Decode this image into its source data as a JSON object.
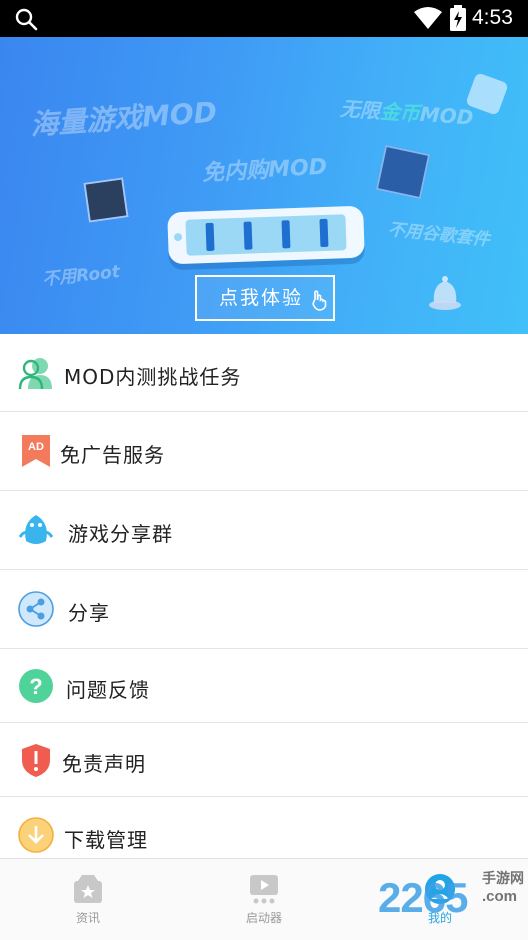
{
  "status_bar": {
    "time": "4:53"
  },
  "banner": {
    "text_1": "海量游戏MOD",
    "text_2_prefix": "无限",
    "text_2_highlight": "金币",
    "text_2_suffix": "MOD",
    "text_3": "免内购MOD",
    "text_4": "不用谷歌套件",
    "text_5": "不用Root",
    "cta_label": "点我体验"
  },
  "menu": {
    "items": [
      {
        "label": "MOD内测挑战任务",
        "icon": "users-icon"
      },
      {
        "label": "免广告服务",
        "icon": "ad-badge-icon"
      },
      {
        "label": "游戏分享群",
        "icon": "penguin-icon"
      },
      {
        "label": "分享",
        "icon": "share-icon"
      },
      {
        "label": "问题反馈",
        "icon": "question-icon"
      },
      {
        "label": "免责声明",
        "icon": "shield-alert-icon"
      },
      {
        "label": "下载管理",
        "icon": "download-icon"
      }
    ]
  },
  "bottom_nav": {
    "tabs": [
      {
        "label": "资讯",
        "icon": "news-box-icon",
        "active": false
      },
      {
        "label": "启动器",
        "icon": "launcher-icon",
        "active": false
      },
      {
        "label": "我的",
        "icon": "profile-icon",
        "active": true
      }
    ]
  },
  "watermark": {
    "number": "2265",
    "cn": "手游网",
    "com": ".com"
  },
  "colors": {
    "accent": "#23a4e4",
    "banner_start": "#3a86f0",
    "banner_end": "#40c0f8"
  }
}
